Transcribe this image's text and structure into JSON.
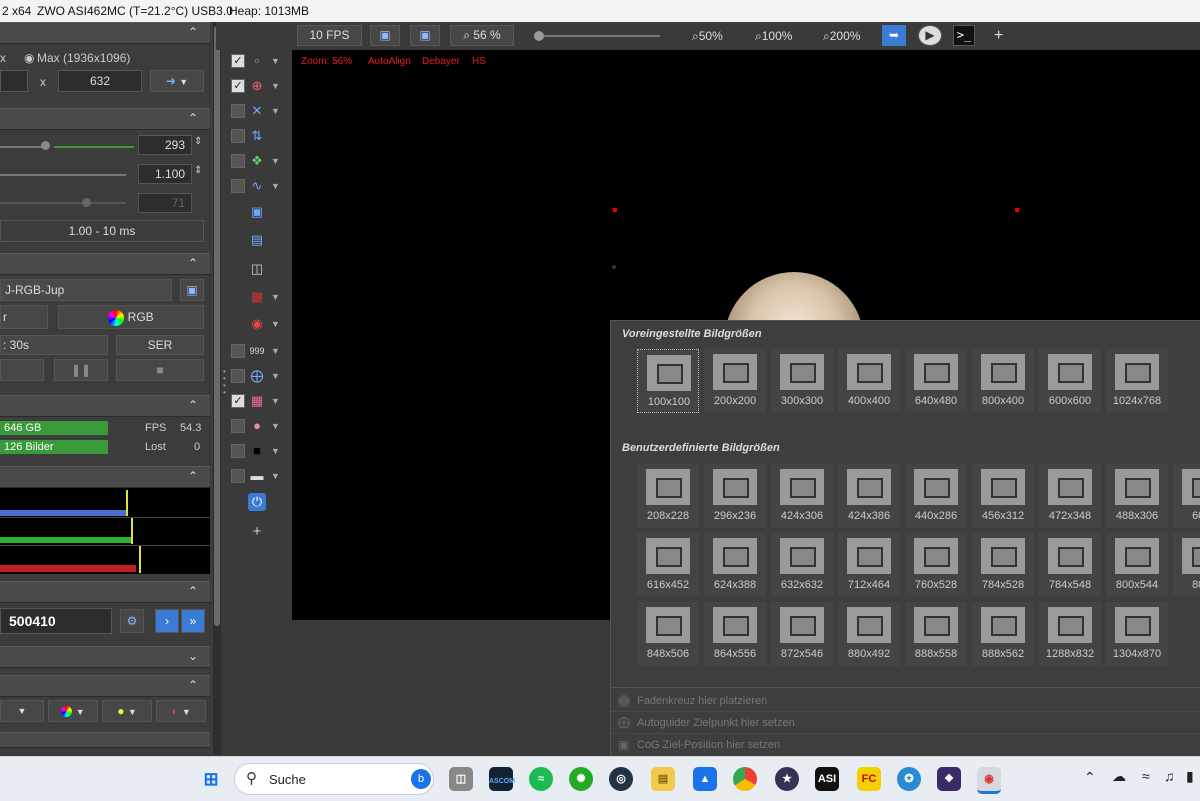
{
  "titlebar": {
    "arch": "2 x64",
    "camera": "ZWO ASI462MC (T=21.2°C) USB3.0",
    "heap": "Heap: 1013MB"
  },
  "capture_area": {
    "prefix": "x",
    "max_label": "Max (1936x1096)",
    "x_sep": "x",
    "height_value": "632"
  },
  "controls": {
    "gain_value": "293",
    "gamma_value": "1.100",
    "third_value": "71",
    "exposure_range": "1.00 - 10 ms",
    "gain_fill": 0.3
  },
  "capture": {
    "profile_name": "J-RGB-Jup",
    "mode_left": "r",
    "color_label": "RGB",
    "duration": ": 30s",
    "format": "SER"
  },
  "status": {
    "disk": "646 GB",
    "frames": "126 Bilder",
    "fps_label": "FPS",
    "fps_value": "54.3",
    "lost_label": "Lost",
    "lost_value": "0"
  },
  "counter": {
    "value": "500410"
  },
  "toolbar": {
    "fps": "10 FPS",
    "zoom_display": "56 %",
    "zoom_50": "50%",
    "zoom_100": "100%",
    "zoom_200": "200%",
    "plus": "+"
  },
  "viewport": {
    "zoom": "Zoom: 56%",
    "autoalign": "AutoAlign",
    "debayer": "Debayer",
    "hs": "HS"
  },
  "tools": {
    "plus": "+"
  },
  "popup": {
    "preset_title": "Voreingestellte Bildgrößen",
    "presets": [
      "100x100",
      "200x200",
      "300x300",
      "400x400",
      "640x480",
      "800x400",
      "600x600",
      "1024x768"
    ],
    "custom_title": "Benutzerdefinierte Bildgrößen",
    "custom_row1": [
      "208x228",
      "296x236",
      "424x306",
      "424x386",
      "440x286",
      "456x312",
      "472x348",
      "488x306",
      "600x"
    ],
    "custom_row2": [
      "616x452",
      "624x388",
      "632x632",
      "712x464",
      "760x528",
      "784x528",
      "784x548",
      "800x544",
      "808x"
    ],
    "custom_row3": [
      "848x506",
      "864x556",
      "872x546",
      "880x492",
      "888x558",
      "888x562",
      "1288x832",
      "1304x870"
    ],
    "menu": [
      "Fadenkreuz hier platzieren",
      "Autoguider Zielpunkt hier setzen",
      "CoG Ziel-Position hier setzen"
    ]
  },
  "taskbar": {
    "search": "Suche",
    "ascom": "ASCOM",
    "asi": "ASI",
    "fc": "FC"
  },
  "colors": {
    "accent_blue": "#3a7bd5",
    "status_green": "#3a9a3a",
    "overlay_red": "#e02020"
  }
}
